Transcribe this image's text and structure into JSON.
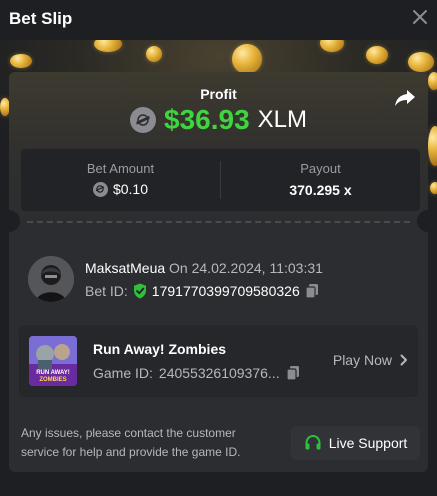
{
  "header": {
    "title": "Bet Slip"
  },
  "profit": {
    "label": "Profit",
    "value": "$36.93",
    "currency": "XLM"
  },
  "stats": {
    "bet_amount_label": "Bet Amount",
    "bet_amount_value": "$0.10",
    "payout_label": "Payout",
    "payout_value": "370.295 x"
  },
  "user": {
    "name": "MaksatMeua",
    "date": "On 24.02.2024, 11:03:31",
    "bet_id_label": "Bet ID:",
    "bet_id": "1791770399709580326"
  },
  "game": {
    "name": "Run Away! Zombies",
    "id_label": "Game ID:",
    "id": "24055326109376...",
    "play_label": "Play Now",
    "thumb_text": "RUN AWAY! ZOMBIES"
  },
  "footer": {
    "note": "Any issues, please contact the customer service for help and provide the game ID.",
    "support_label": "Live Support"
  },
  "colors": {
    "profit_green": "#3ed53e",
    "background": "#1e1f22",
    "card": "#2c2d31",
    "verified_green": "#2fbf3a"
  },
  "icons": [
    "close-icon",
    "share-icon",
    "stellar-xlm-icon",
    "shield-check-icon",
    "copy-icon",
    "chevron-right-icon",
    "headset-icon"
  ]
}
